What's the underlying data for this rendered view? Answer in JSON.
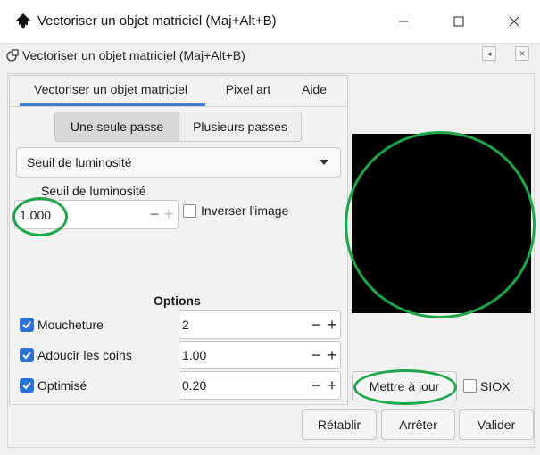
{
  "window": {
    "title": "Vectoriser un objet matriciel (Maj+Alt+B)",
    "icon": "inkscape-logo-icon",
    "controls": [
      "minimize-icon",
      "maximize-icon",
      "close-icon"
    ]
  },
  "dock": {
    "title": "Vectoriser un objet matriciel (Maj+Alt+B)",
    "icon": "dialog-icon"
  },
  "tabs": [
    {
      "label": "Vectoriser un objet matriciel",
      "active": true
    },
    {
      "label": "Pixel art",
      "active": false
    },
    {
      "label": "Aide",
      "active": false
    }
  ],
  "mode": {
    "single": "Une seule passe",
    "multiple": "Plusieurs passes",
    "selected": "single"
  },
  "method": {
    "selected": "Seuil de luminosité"
  },
  "threshold": {
    "label": "Seuil de luminosité",
    "value": "1.000",
    "minus": "−",
    "plus": "+"
  },
  "invert": {
    "label": "Inverser l'image",
    "checked": false
  },
  "options": {
    "title": "Options",
    "items": [
      {
        "label": "Moucheture",
        "checked": true,
        "value": "2"
      },
      {
        "label": "Adoucir les coins",
        "checked": true,
        "value": "1.00"
      },
      {
        "label": "Optimisé",
        "checked": true,
        "value": "0.20"
      }
    ],
    "minus": "−",
    "plus": "+"
  },
  "preview": {
    "update_label": "Mettre à jour",
    "siox_label": "SIOX",
    "siox_checked": false
  },
  "footer": {
    "reset_label": "Rétablir",
    "stop_label": "Arrêter",
    "ok_label": "Valider"
  },
  "colors": {
    "accent": "#2c71d6",
    "annotation": "#1fa54a",
    "preview_bg": "#000000"
  }
}
